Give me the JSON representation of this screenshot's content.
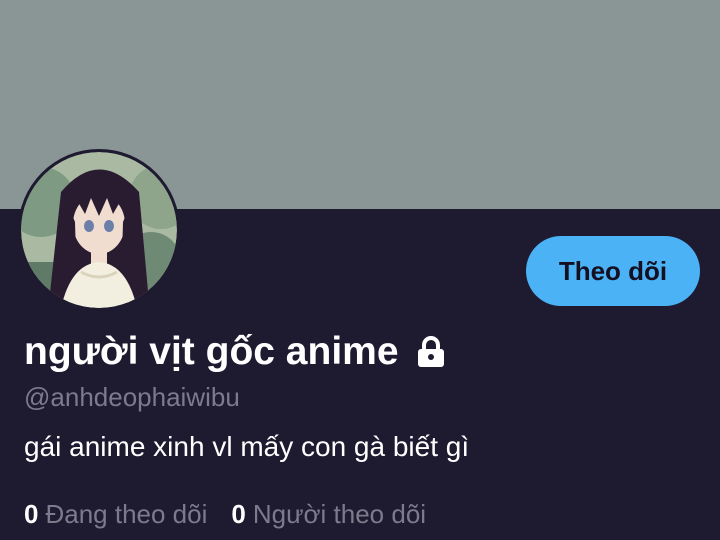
{
  "profile": {
    "display_name": "người vịt gốc anime",
    "handle": "@anhdeophaiwibu",
    "bio": "gái anime xinh vl mấy con gà biết gì",
    "locked_icon": "lock-icon",
    "avatar": "anime-girl-avatar"
  },
  "actions": {
    "follow_label": "Theo dõi"
  },
  "stats": {
    "following_count": "0",
    "following_label": "Đang theo dõi",
    "followers_count": "0",
    "followers_label": "Người theo dõi"
  },
  "colors": {
    "banner": "#8a9596",
    "background": "#1e1a30",
    "accent": "#4ab2f5",
    "text_primary": "#ffffff",
    "text_secondary": "#7d7a8c"
  }
}
